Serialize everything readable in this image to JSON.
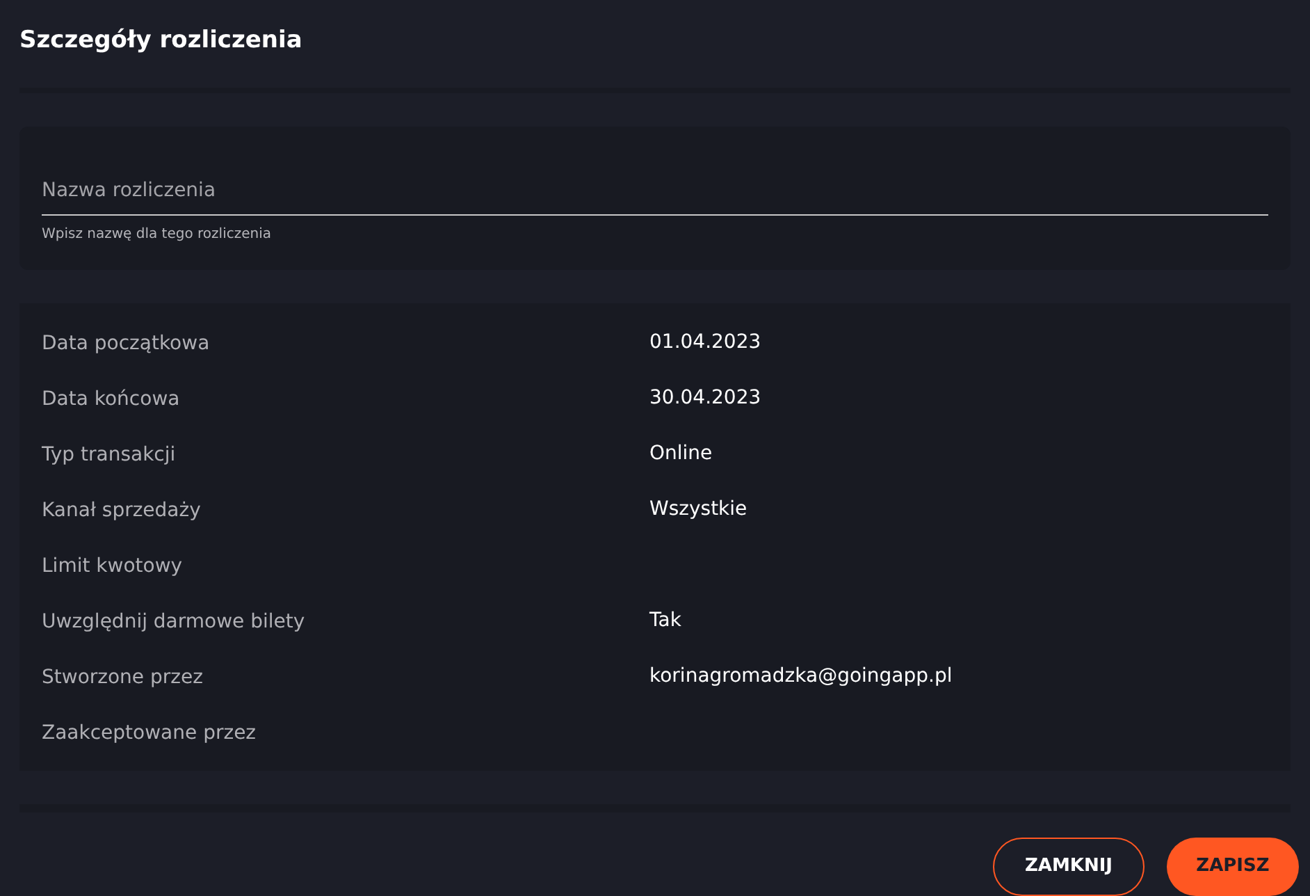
{
  "title": "Szczegóły rozliczenia",
  "name_field": {
    "placeholder": "Nazwa rozliczenia",
    "helper": "Wpisz nazwę dla tego rozliczenia"
  },
  "details": [
    {
      "label": "Data początkowa",
      "value": "01.04.2023"
    },
    {
      "label": "Data końcowa",
      "value": "30.04.2023"
    },
    {
      "label": "Typ transakcji",
      "value": "Online"
    },
    {
      "label": "Kanał sprzedaży",
      "value": "Wszystkie"
    },
    {
      "label": "Limit kwotowy"
    },
    {
      "label": "Uwzględnij darmowe bilety",
      "value": "Tak"
    },
    {
      "label": "Stworzone przez",
      "value": "korinagromadzka@goingapp.pl"
    },
    {
      "label": "Zaakceptowane przez"
    }
  ],
  "buttons": [
    {
      "label": "ZAMKNIJ",
      "kind": "outline"
    },
    {
      "label": "ZAPISZ",
      "kind": "filled"
    }
  ]
}
